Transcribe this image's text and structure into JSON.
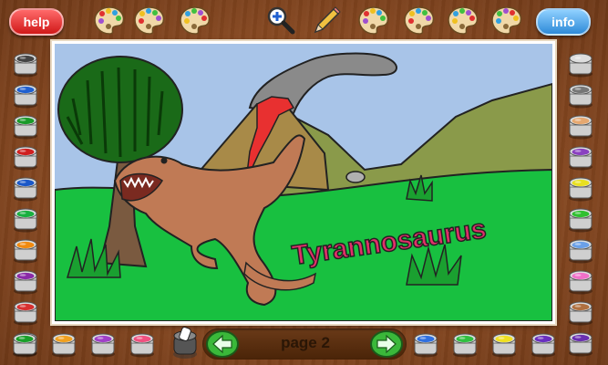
{
  "header": {
    "help_label": "help",
    "info_label": "info",
    "palette_icons": [
      "palette-icon",
      "palette-icon",
      "palette-icon",
      "zoom-icon",
      "pencil-icon",
      "palette-icon",
      "palette-icon",
      "palette-icon",
      "palette-icon"
    ]
  },
  "canvas": {
    "caption": "Tyrannosaurus"
  },
  "colors": {
    "left": [
      "#444444",
      "#2060d0",
      "#1a9a2a",
      "#d02020",
      "#1a58c8",
      "#19b040",
      "#f08a10",
      "#8a2aa8",
      "#d83030",
      "#1a50d0"
    ],
    "right": [
      "#dddddd",
      "#777777",
      "#e6a870",
      "#8a40c0",
      "#e8e020",
      "#30c030",
      "#6aa0e8",
      "#f070c8",
      "#b07040",
      "#6a30b0"
    ],
    "bottom": [
      "#1aa02a",
      "#f0a020",
      "#a040c8",
      "#f05080",
      "#3070e0",
      "#30c040",
      "#f0e020",
      "#6a30c0"
    ]
  },
  "navigation": {
    "page_label": "page 2",
    "prev_icon": "left-arrow-icon",
    "next_icon": "right-arrow-icon"
  }
}
